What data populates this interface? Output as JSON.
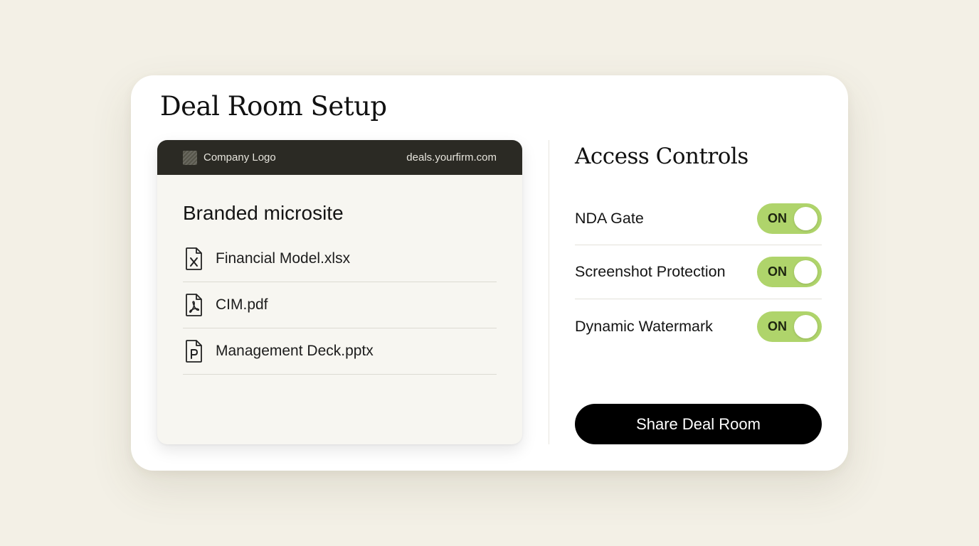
{
  "page": {
    "title": "Deal Room Setup"
  },
  "preview": {
    "logo_label": "Company Logo",
    "domain": "deals.yourfirm.com",
    "heading": "Branded microsite",
    "files": [
      {
        "name": "Financial Model.xlsx",
        "icon": "excel-file-icon"
      },
      {
        "name": "CIM.pdf",
        "icon": "pdf-file-icon"
      },
      {
        "name": "Management Deck.pptx",
        "icon": "powerpoint-file-icon"
      }
    ]
  },
  "access_controls": {
    "title": "Access Controls",
    "items": [
      {
        "label": "NDA Gate",
        "state": "ON"
      },
      {
        "label": "Screenshot Protection",
        "state": "ON"
      },
      {
        "label": "Dynamic Watermark",
        "state": "ON"
      }
    ],
    "toggle_color": "#afd46b"
  },
  "actions": {
    "share_label": "Share Deal Room"
  }
}
